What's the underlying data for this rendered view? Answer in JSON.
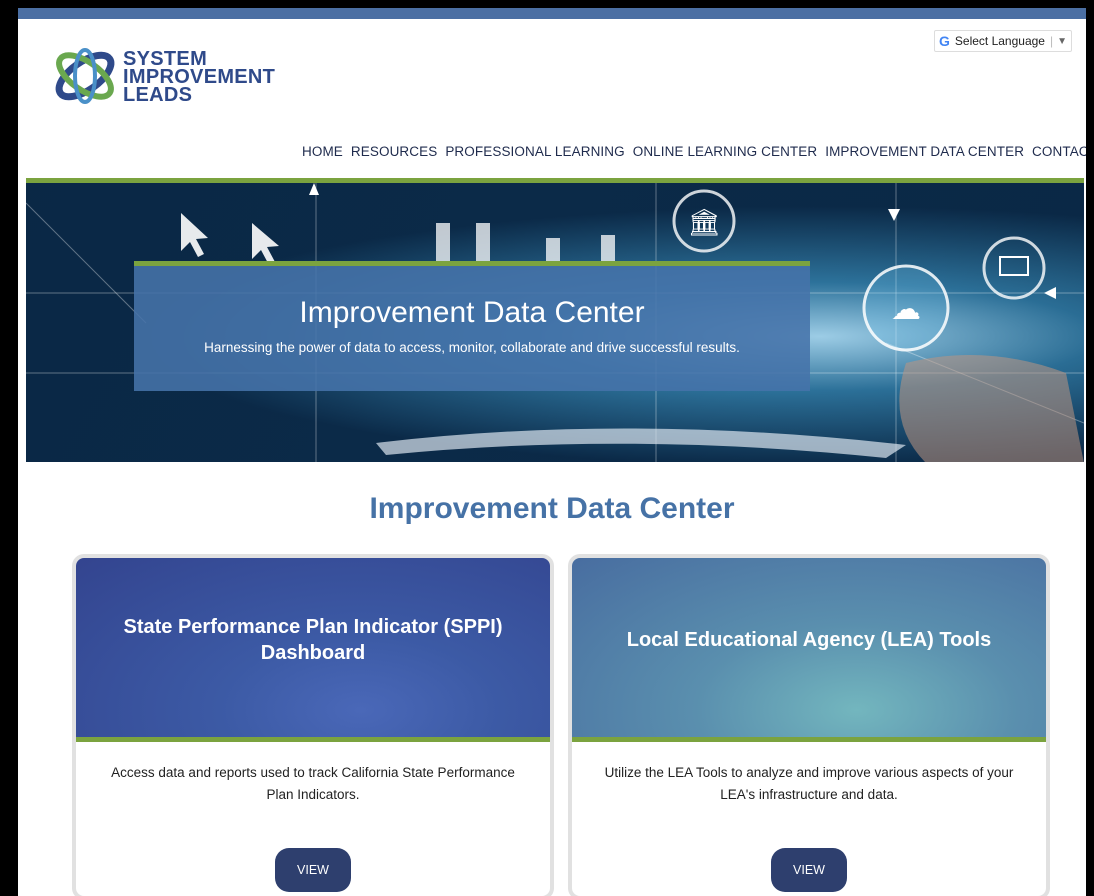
{
  "logo": {
    "line1": "SYSTEM",
    "line2": "IMPROVEMENT",
    "line3": "LEADS"
  },
  "language": {
    "label": "Select Language",
    "google_icon": "google-g-icon",
    "arrow_icon": "dropdown-arrow-icon"
  },
  "nav": [
    "HOME",
    "RESOURCES",
    "PROFESSIONAL LEARNING",
    "ONLINE LEARNING CENTER",
    "IMPROVEMENT DATA CENTER",
    "CONTACT US"
  ],
  "hero": {
    "title": "Improvement Data Center",
    "subtitle": "Harnessing the power of data to access, monitor, collaborate and drive successful results."
  },
  "section_title": "Improvement Data Center",
  "cards": [
    {
      "title": "State Performance Plan Indicator (SPPI) Dashboard",
      "description": "Access data and reports used to track California State Performance Plan Indicators.",
      "button": "VIEW"
    },
    {
      "title": "Local Educational Agency (LEA) Tools",
      "description": "Utilize the LEA Tools to analyze and improve various aspects of your LEA's infrastructure and data.",
      "button": "VIEW"
    }
  ],
  "colors": {
    "accent_green": "#7ba33f",
    "brand_blue": "#4672a6",
    "button": "#2e3f6e"
  }
}
